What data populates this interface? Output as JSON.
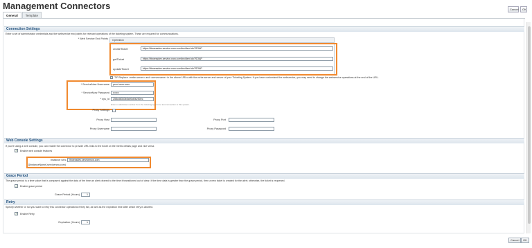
{
  "page": {
    "title": "Management Connectors",
    "top_cancel": "Cancel",
    "top_ok": "OK",
    "tabs": [
      "General",
      "Template"
    ]
  },
  "connection": {
    "heading": "Connection Settings",
    "description": "Enter a set of administrator credentials and the webservice end points for relevant operations of the ticketing system. These are required for communications.",
    "endpoints_label": "* Web Service End Points",
    "endpoints_header": "Operation",
    "endpoints": [
      {
        "op": "createTicket",
        "url": "https://itnoessdev.service-now.com/incident.do?SOAP"
      },
      {
        "op": "getTicket",
        "url": "https://itnoessdev.service-now.com/incident.do?SOAP"
      },
      {
        "op": "updateTicket",
        "url": "https://itnoessdev.service-now.com/incident.do?SOAP"
      }
    ],
    "tip": "TIP Replace <mrbe-server> and <servername> in the above URLs with the mrbe server and server of your Ticketing System. If you have customized the webservice, you may need to change the webservice operations at the end of the URL.",
    "username_label": "* ServiceNow Username",
    "username_value": "provi-oem-user",
    "password_label": "* ServiceNow Password",
    "password_value": "•••••••",
    "sysid_label": "* sys_id",
    "sysid_value": "258cd8353b5a90d0b250ec",
    "sysid_hint": "Enter a valid ticket number from the ticketing system to test connection to this system.",
    "proxy_settings_label": "Proxy Settings",
    "proxy_host_label": "Proxy Host",
    "proxy_port_label": "Proxy Port",
    "proxy_user_label": "Proxy Username",
    "proxy_pass_label": "Proxy Password"
  },
  "webconsole": {
    "heading": "Web Console Settings",
    "description": "If you're using a web console, you can enable the connector to provide URL links to the ticket on the metric details page and vice versa.",
    "enable_label": "Enable web console features",
    "instance_label": "Instance URL",
    "instance_value": "itnoessdev.servicenow.com",
    "instance_hint": "[[InstanceName].servicenow.com)"
  },
  "grace": {
    "heading": "Grace Period",
    "description": "The grace period is a time value that is compared against the data of the time an alert cleared to the time it transitioned out of clear. If the time data is greater than the grace period, then a new ticket is created for the alert; otherwise, the ticket is reopened.",
    "enable_label": "Enable grace period",
    "field_label": "Grace Period (Hours)",
    "field_value": "1"
  },
  "retry": {
    "heading": "Retry",
    "description": "Specify whether or not you want to retry this connector operations if they fail, as well as the expiration time after which retry is aborted.",
    "enable_label": "Enable Retry",
    "field_label": "Expiration (Hours)",
    "field_value": "1"
  },
  "footer": {
    "cancel": "Cancel",
    "ok": "OK"
  },
  "colors": {
    "highlight": "#f0892e",
    "section_text": "#1e4f7d"
  }
}
